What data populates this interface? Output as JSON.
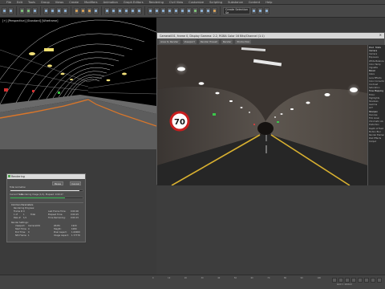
{
  "menubar": {
    "items": [
      "File",
      "Edit",
      "Tools",
      "Group",
      "Views",
      "Create",
      "Modifiers",
      "Animation",
      "Graph Editors",
      "Rendering",
      "Civil View",
      "Customize",
      "Scripting",
      "Substance",
      "Content",
      "Help"
    ]
  },
  "toolbar": {
    "selection_set": "Create Selection Se"
  },
  "viewport_left": {
    "label": "[+] [Perspective] [Standard] [Wireframe]"
  },
  "render_window": {
    "title": "Camera001, frame 0, Display Gamma: 2.2, RGBA Color 16 Bits/Channel (1:1)",
    "tools": [
      "Area to Render",
      "Viewport",
      "Render Preset",
      "Render",
      "Production"
    ],
    "side_tabs": [
      "Post",
      "Stats"
    ],
    "side_items": [
      "Camera",
      "Camera",
      "Exposure",
      "White Balance",
      "Color Temp",
      "Vignette",
      "Bloom",
      "Glare",
      "Lens Effects",
      "Color Correction",
      "Contrast",
      "Saturation",
      "Tone Mapping",
      "Filmic",
      "Highlights",
      "Shadows",
      "Gamma",
      "LUT",
      "Sharpen",
      "Denoise",
      "Film Grain",
      "Chromatic Ab.",
      "Distortion",
      "Depth of Field",
      "Motion Blur",
      "Render Elements",
      "Post Effects",
      "Output"
    ],
    "sign_text": "70"
  },
  "render_dialog": {
    "title": "Rendering",
    "pause_label": "Pause",
    "cancel_label": "Cancel",
    "total_animation_label": "Total Animation",
    "current_task_label": "Current Task:",
    "current_task_value": "Rendering Image (1/1), Elapsed: 0:00:27",
    "common_params_label": "Common Parameters",
    "rendering_progress_label": "Rendering Progress:",
    "frame_label": "Frame #",
    "frame_value": "0",
    "of_label": "1 of",
    "of_value": "1",
    "pass_label": "Pass #",
    "pass_value": "1/1",
    "total_label": "Total",
    "last_frame_time_label": "Last Frame Time:",
    "last_frame_time_value": "0:00:00",
    "elapsed_time_label": "Elapsed Time:",
    "elapsed_time_value": "0:00:25",
    "time_remaining_label": "Time Remaining:",
    "time_remaining_value": "0:00:15",
    "render_settings_label": "Render Settings:",
    "viewport_label": "Viewport:",
    "viewport_value": "Camera001",
    "width_label": "Width:",
    "width_value": "1920",
    "start_time_label": "Start Time:",
    "start_time_value": "0",
    "height_label": "Height:",
    "height_value": "1080",
    "end_time_label": "End Time:",
    "end_time_value": "0",
    "pixel_aspect_label": "Pixel Aspect:",
    "pixel_aspect_value": "1.00000",
    "nth_frame_label": "Nth Frame:",
    "nth_frame_value": "1",
    "image_aspect_label": "Image Aspect:",
    "image_aspect_value": "1.77778",
    "progress_total": 0.95,
    "progress_task": 0.75
  },
  "statusbar": {
    "ticks": [
      "0",
      "10",
      "20",
      "30",
      "40",
      "50",
      "60",
      "70",
      "80",
      "90",
      "100"
    ],
    "grid_label": "Grid = 10.0cm"
  },
  "colors": {
    "progress_green": "#2fb34a",
    "window_title_bg": "#d7d7d7",
    "sign_red": "#c81e1e"
  }
}
